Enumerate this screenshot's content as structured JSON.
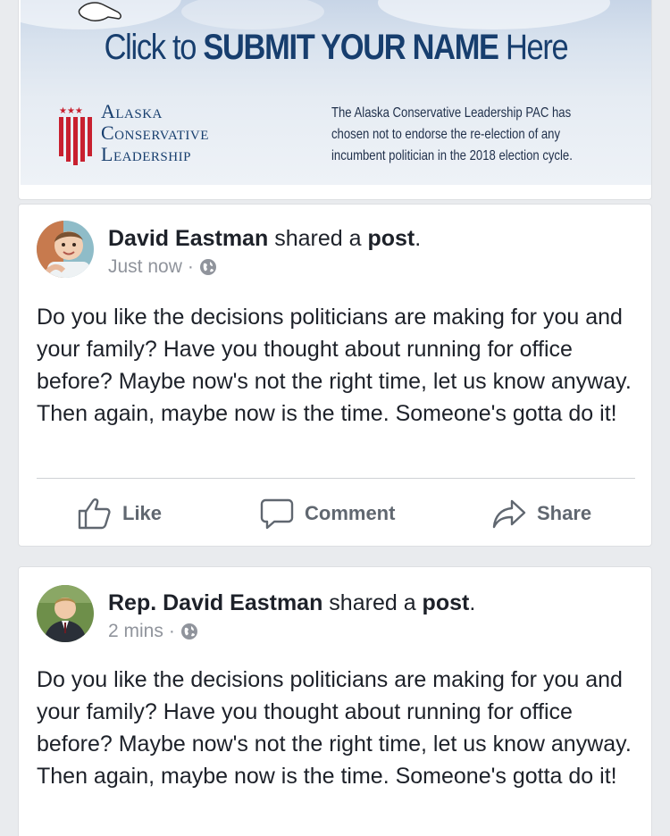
{
  "banner": {
    "headline_prefix": "Click to ",
    "headline_bold": "SUBMIT YOUR NAME",
    "headline_suffix": " Here",
    "logo_lines": [
      "Alaska",
      "Conservative",
      "Leadership"
    ],
    "notice_lines": [
      "The Alaska Conservative Leadership PAC has",
      "chosen not to endorse the re-election of any",
      "incumbent politician in the 2018 election cycle."
    ]
  },
  "posts": [
    {
      "author": "David Eastman",
      "shared_text": " shared a ",
      "shared_object": "post",
      "period": ".",
      "timestamp": "Just now",
      "separator": "·",
      "privacy_icon": "globe-icon",
      "body": "Do you like the decisions politicians are making for you and your family? Have you thought about running for office before? Maybe now's not the right time, let us know anyway. Then again, maybe now is the time. Someone's gotta do it!",
      "actions": {
        "like": "Like",
        "comment": "Comment",
        "share": "Share"
      }
    },
    {
      "author": "Rep. David Eastman",
      "shared_text": " shared a ",
      "shared_object": "post",
      "period": ".",
      "timestamp": "2 mins",
      "separator": "·",
      "privacy_icon": "globe-icon",
      "body": "Do you like the decisions politicians are making for you and your family? Have you thought about running for office before? Maybe now's not the right time, let us know anyway. Then again, maybe now is the time. Someone's gotta do it!"
    }
  ],
  "colors": {
    "page_bg": "#e9ebee",
    "banner_navy": "#173e6e",
    "flag_red": "#c8202f",
    "text_primary": "#1d2129",
    "text_meta": "#90949c",
    "action_gray": "#606770"
  }
}
